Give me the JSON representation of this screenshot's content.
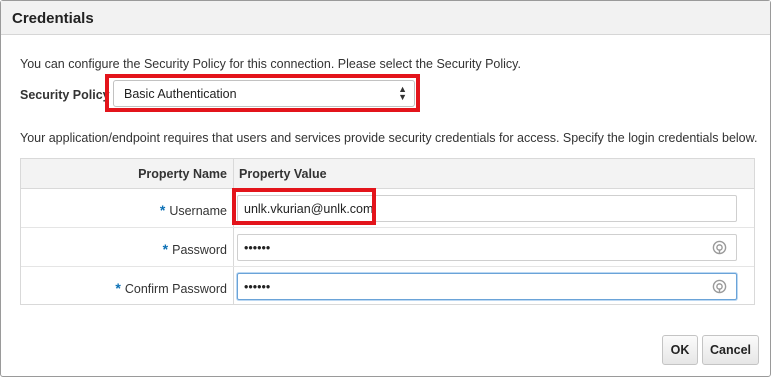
{
  "dialog": {
    "title": "Credentials",
    "intro_text": "You can configure the Security Policy for this connection. Please select the Security Policy.",
    "security_policy": {
      "label": "Security Policy",
      "selected": "Basic Authentication"
    },
    "description": "Your application/endpoint requires that users and services provide security credentials for access. Specify the login credentials below."
  },
  "table": {
    "headers": [
      "Property Name",
      "Property Value"
    ],
    "rows": [
      {
        "label": "Username",
        "required": "*",
        "value": "unlk.vkurian@unlk.com",
        "masked": false
      },
      {
        "label": "Password",
        "required": "*",
        "value": "••••••",
        "masked": true,
        "icon": "reveal-password-icon"
      },
      {
        "label": "Confirm Password",
        "required": "*",
        "value": "••••••",
        "masked": true,
        "icon": "reveal-password-icon"
      }
    ]
  },
  "buttons": {
    "ok": "OK",
    "cancel": "Cancel"
  },
  "colors": {
    "highlight": "#e3141b",
    "required_marker": "#0b70b5",
    "focus_border": "#6aa3d8"
  }
}
